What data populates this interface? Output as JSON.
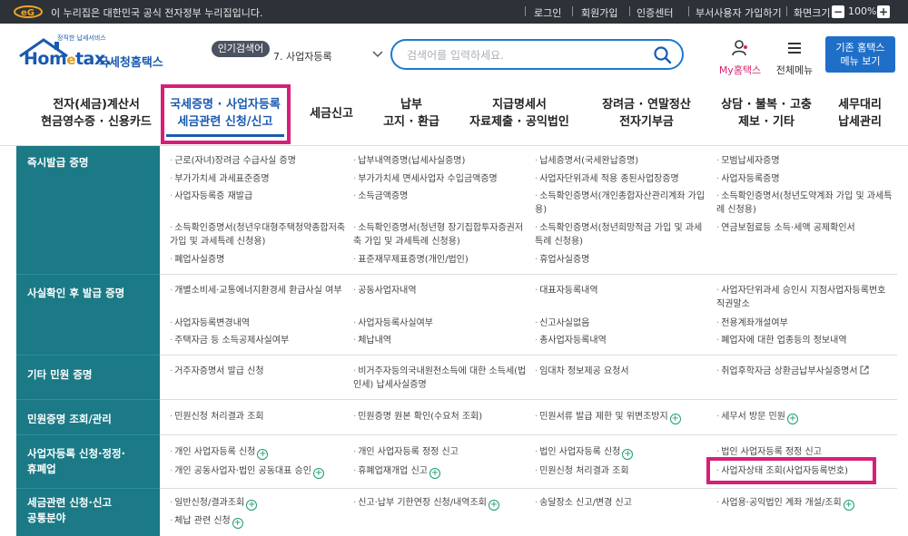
{
  "gov_banner": {
    "text": "이 누리집은 대한민국 공식 전자정부 누리집입니다.",
    "links": [
      "로그인",
      "회원가입",
      "인증센터",
      "부서사용자 가입하기",
      "화면크기"
    ],
    "zoom_level": "100%",
    "zoom_minus": "−",
    "zoom_plus": "+"
  },
  "header": {
    "logo_tagline": "정직한 납세서비스",
    "logo_name_part1": "Hom",
    "logo_name_e": "e",
    "logo_name_part2": "tax.",
    "logo_korean": "국세청홈택스",
    "popular_badge": "인기검색어",
    "popular_item": "7.  사업자등록",
    "search_placeholder": "검색어를 입력하세요.",
    "mytax_label": "My홈택스",
    "allmenu_label": "전체메뉴",
    "classic_btn_line1": "기존 홈택스",
    "classic_btn_line2": "메뉴 보기"
  },
  "nav": [
    {
      "line1": "전자(세금)계산서",
      "line2": "현금영수증 · 신용카드"
    },
    {
      "line1": "국세증명 · 사업자등록",
      "line2": "세금관련 신청/신고"
    },
    {
      "line1": "세금신고",
      "line2": ""
    },
    {
      "line1": "납부",
      "line2": "고지 · 환급"
    },
    {
      "line1": "지급명세서",
      "line2": "자료제출 · 공익법인"
    },
    {
      "line1": "장려금 · 연말정산",
      "line2": "전자기부금"
    },
    {
      "line1": "상담 · 불복 · 고충",
      "line2": "제보 · 기타"
    },
    {
      "line1": "세무대리",
      "line2": "납세관리"
    }
  ],
  "sections": [
    {
      "category": "즉시발급 증명",
      "items": [
        "근로(자녀)장려금 수급사실 증명",
        "납부내역증명(납세사실증명)",
        "납세증명서(국세완납증명)",
        "모범납세자증명",
        "부가가치세 과세표준증명",
        "부가가치세 면세사업자 수입금액증명",
        "사업자단위과세 적용 종된사업장증명",
        "사업자등록증명",
        "사업자등록증 재발급",
        "소득금액증명",
        "소득확인증명서(개인종합자산관리계좌 가입용)",
        "소득확인증명서(청년도약계좌 가입 및 과세특례 신청용)",
        "소득확인증명서(청년우대형주택청약종합저축 가입 및 과세특례 신청용)",
        "소득확인증명서(청년형 장기집합투자증권저축 가입 및 과세특례 신청용)",
        "소득확인증명서(청년희망적금 가입 및 과세특례 신청용)",
        "연금보험료등 소득·세액 공제확인서",
        "폐업사실증명",
        "표준재무제표증명(개인/법인)",
        "휴업사실증명"
      ]
    },
    {
      "category": "사실확인 후 발급 증명",
      "items": [
        "개별소비세·교통에너지환경세 환급사실 여부",
        "공동사업자내역",
        "대표자등록내역",
        "사업자단위과세 승인시 지점사업자등록번호 직권말소",
        "사업자등록변경내역",
        "사업자등록사실여부",
        "신고사실없음",
        "전용계좌개설여부",
        "주택자금 등 소득공제사실여부",
        "체납내역",
        "총사업자등록내역",
        "폐업자에 대한 업종등의 정보내역"
      ]
    },
    {
      "category": "기타 민원 증명",
      "items": [
        "거주자증명서 발급 신청",
        "비거주자등의국내원천소득에 대한 소득세(법인세) 납세사실증명",
        "임대차 정보제공 요청서",
        "취업후학자금 상환금납부사실증명서"
      ]
    },
    {
      "category": "민원증명 조회/관리",
      "items": [
        "민원신청 처리결과 조회",
        "민원증명 원본 확인(수요처 조회)",
        "민원서류 발급 제한 및 위변조방지",
        "세무서 방문 민원"
      ]
    },
    {
      "category_line1": "사업자등록 신청·정정·",
      "category_line2": "휴폐업",
      "items": [
        "개인 사업자등록 신청",
        "개인 사업자등록 정정 신고",
        "법인 사업자등록 신청",
        "법인 사업자등록 정정 신고",
        "개인 공동사업자·법인 공동대표 승인",
        "휴폐업재개업 신고",
        "민원신청 처리결과 조회",
        "사업자상태 조회(사업자등록번호)"
      ]
    },
    {
      "category_line1": "세금관련 신청·신고",
      "category_line2": "공통분야",
      "items": [
        "일반신청/결과조회",
        "신고·납부 기한연장 신청/내역조회",
        "송달장소 신고/변경 신고",
        "사업용·공익법인 계좌 개설/조회",
        "체납 관련 신청"
      ]
    }
  ],
  "colors": {
    "category_bg": "#1b7a86",
    "highlight": "#d81e78",
    "accent": "#1a5ab0",
    "plus_icon": "#1a9e6c"
  }
}
